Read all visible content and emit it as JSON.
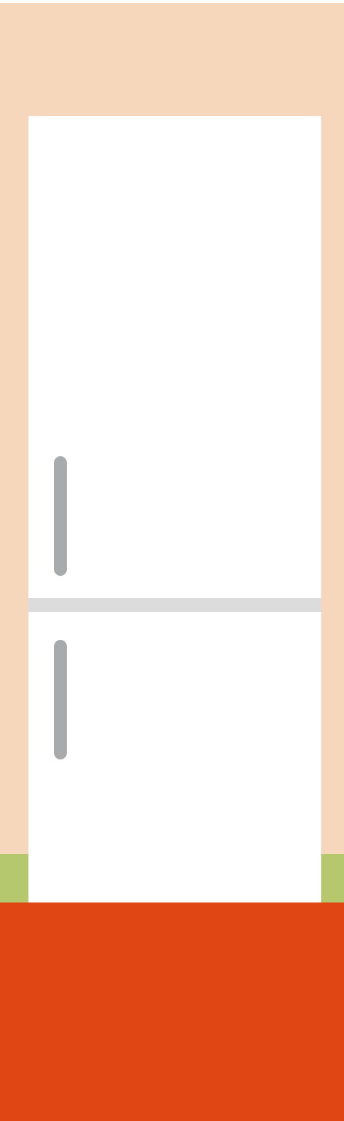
{
  "colors": {
    "wall": "#f6d7bb",
    "baseboard": "#b6c86d",
    "floor": "#e04514",
    "fridge_body": "#ffffff",
    "door_gap": "#dcdcdc",
    "handle": "#a9aaac"
  },
  "icons": {
    "fridge": "refrigerator-icon",
    "handle": "door-handle-icon"
  }
}
